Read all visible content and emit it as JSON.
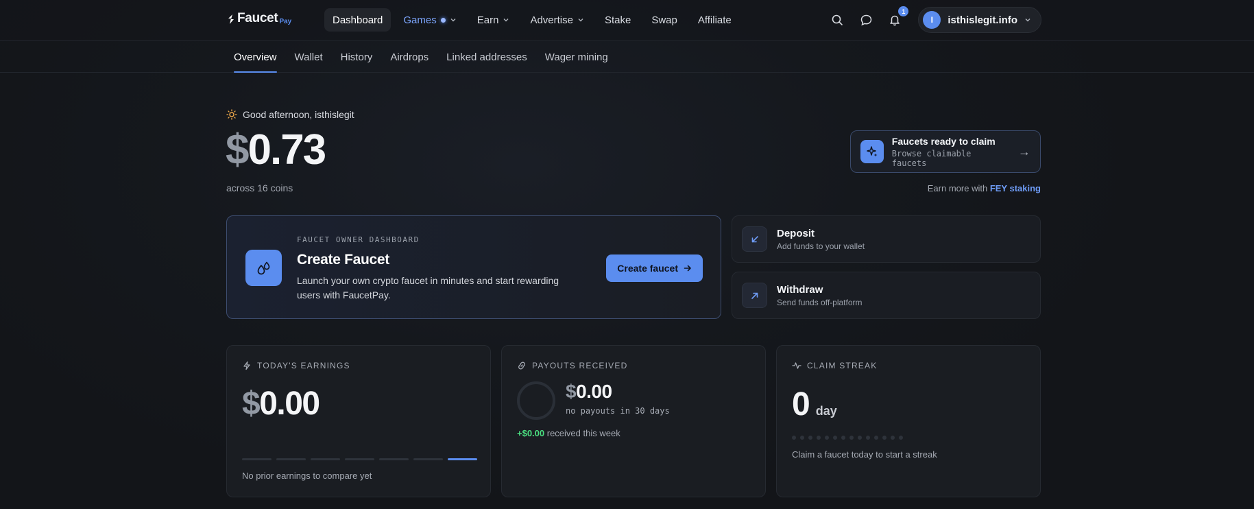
{
  "brand": {
    "name": "Faucet",
    "suffix": "Pay",
    "accent": "#5b8def"
  },
  "nav": {
    "items": [
      {
        "label": "Dashboard",
        "active": true
      },
      {
        "label": "Games",
        "dropdown": true,
        "indicator": true
      },
      {
        "label": "Earn",
        "dropdown": true
      },
      {
        "label": "Advertise",
        "dropdown": true
      },
      {
        "label": "Stake"
      },
      {
        "label": "Swap"
      },
      {
        "label": "Affiliate"
      }
    ],
    "icons": [
      "search-icon",
      "chat-icon",
      "bell-icon"
    ],
    "notification_count": "1",
    "user": {
      "initial": "I",
      "name": "isthislegit.info"
    }
  },
  "subnav": {
    "tabs": [
      {
        "label": "Overview",
        "active": true
      },
      {
        "label": "Wallet"
      },
      {
        "label": "History"
      },
      {
        "label": "Airdrops"
      },
      {
        "label": "Linked addresses"
      },
      {
        "label": "Wager mining"
      }
    ]
  },
  "hero": {
    "greeting": "Good afternoon, isthislegit",
    "currency": "$",
    "balance": "0.73",
    "coins_note": "across 16 coins"
  },
  "ready": {
    "title": "Faucets ready to claim",
    "subtitle": "Browse claimable faucets",
    "arrow": "→"
  },
  "earn_more": {
    "prefix": "Earn more with",
    "link": "FEY staking"
  },
  "create": {
    "label": "FAUCET OWNER DASHBOARD",
    "title": "Create Faucet",
    "description": "Launch your own crypto faucet in minutes and start rewarding users with FaucetPay.",
    "button": "Create faucet"
  },
  "deposit": {
    "title": "Deposit",
    "subtitle": "Add funds to your wallet"
  },
  "withdraw": {
    "title": "Withdraw",
    "subtitle": "Send funds off-platform"
  },
  "earnings": {
    "label": "TODAY'S EARNINGS",
    "currency": "$",
    "amount": "0.00",
    "note": "No prior earnings to compare yet",
    "bars_total": 7,
    "bars_active_index": 6
  },
  "payouts": {
    "label": "PAYOUTS RECEIVED",
    "currency": "$",
    "amount": "0.00",
    "subtitle": "no payouts in 30 days",
    "week_amount": "+$0.00",
    "week_suffix": "received this week"
  },
  "streak": {
    "label": "CLAIM STREAK",
    "value": "0",
    "unit": "day",
    "dot_count": 14,
    "note": "Claim a faucet today to start a streak"
  }
}
